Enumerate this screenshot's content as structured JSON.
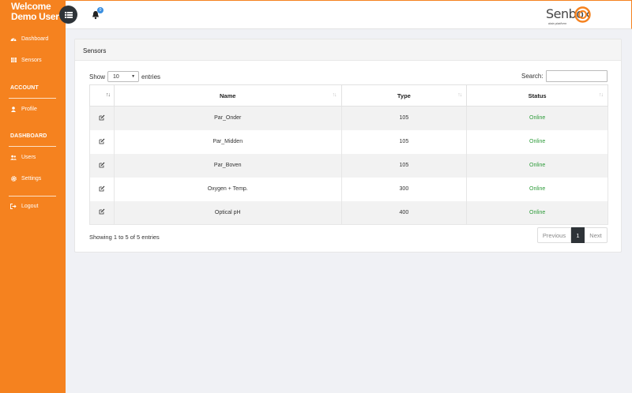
{
  "sidebar": {
    "welcome_line1": "Welcome",
    "welcome_line2": "Demo User",
    "items": [
      {
        "label": "Dashboard",
        "icon": "tachometer-icon"
      },
      {
        "label": "Sensors",
        "icon": "table-icon"
      },
      {
        "label": "Profile",
        "icon": "user-icon"
      },
      {
        "label": "Users",
        "icon": "users-icon"
      },
      {
        "label": "Settings",
        "icon": "gear-icon"
      },
      {
        "label": "Logout",
        "icon": "sign-out-icon"
      }
    ],
    "sections": [
      "ACCOUNT",
      "DASHBOARD"
    ],
    "bg_color": "#f5821f"
  },
  "topbar": {
    "notification_count": "0",
    "logo_text": "Senbox",
    "logo_subtext": "data platform"
  },
  "card": {
    "title": "Sensors",
    "show_label": "Show",
    "entries_value": "10",
    "entries_label": "entries",
    "search_label": "Search:",
    "search_value": "",
    "columns": [
      "",
      "Name",
      "Type",
      "Status"
    ],
    "rows": [
      {
        "name": "Par_Onder",
        "type": "105",
        "status": "Online"
      },
      {
        "name": "Par_Midden",
        "type": "105",
        "status": "Online"
      },
      {
        "name": "Par_Boven",
        "type": "105",
        "status": "Online"
      },
      {
        "name": "Oxygen + Temp.",
        "type": "300",
        "status": "Online"
      },
      {
        "name": "Optical pH",
        "type": "400",
        "status": "Online"
      }
    ],
    "info": "Showing 1 to 5 of 5 entries",
    "pagination": {
      "previous": "Previous",
      "current": "1",
      "next": "Next"
    }
  },
  "colors": {
    "accent": "#f5821f",
    "online": "#2e9b3a",
    "dark": "#2e3338"
  }
}
